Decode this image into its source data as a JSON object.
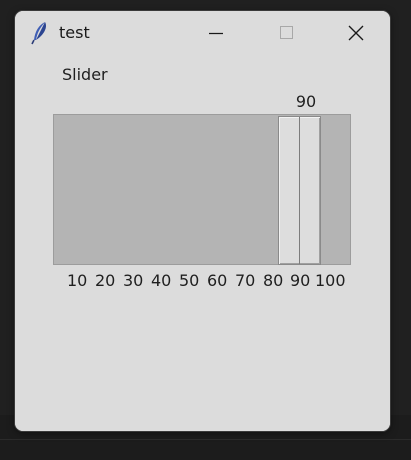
{
  "window": {
    "title": "test",
    "app_icon": "feather-icon",
    "controls": {
      "minimize": "minimize-icon",
      "maximize": "maximize-icon",
      "close": "close-icon"
    }
  },
  "slider": {
    "label": "Slider",
    "value": "90",
    "from": 10,
    "to": 100,
    "tick_labels": [
      "10",
      "20",
      "30",
      "40",
      "50",
      "60",
      "70",
      "80",
      "90",
      "100"
    ]
  },
  "colors": {
    "window_bg": "#dcdcdc",
    "trough": "#b4b4b4",
    "thumb": "#dddddd",
    "desktop": "#202020"
  }
}
